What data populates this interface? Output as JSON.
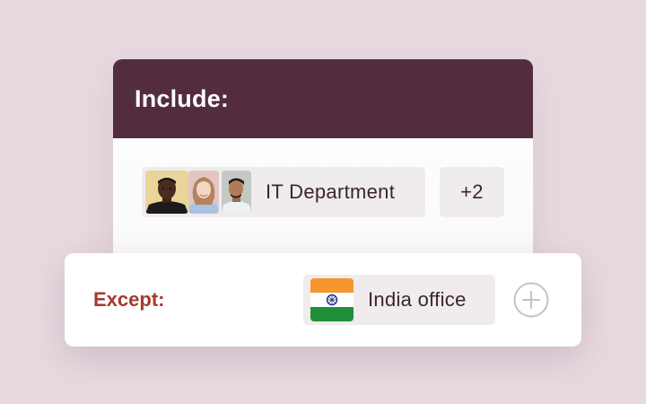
{
  "include": {
    "title": "Include:",
    "group_chip": {
      "label": "IT Department",
      "avatars": [
        "person-avatar",
        "person-avatar",
        "person-avatar"
      ]
    },
    "more_chip": {
      "label": "+2"
    }
  },
  "except": {
    "title": "Except:",
    "office_chip": {
      "label": "India office",
      "flag_icon": "india-flag-icon"
    },
    "add_icon": "plus-circle-icon"
  },
  "colors": {
    "background": "#e8d9e0",
    "header": "#532d3e",
    "except_label": "#a53a2c",
    "chip": "#f0ecee",
    "chip_text": "#3b2430"
  }
}
